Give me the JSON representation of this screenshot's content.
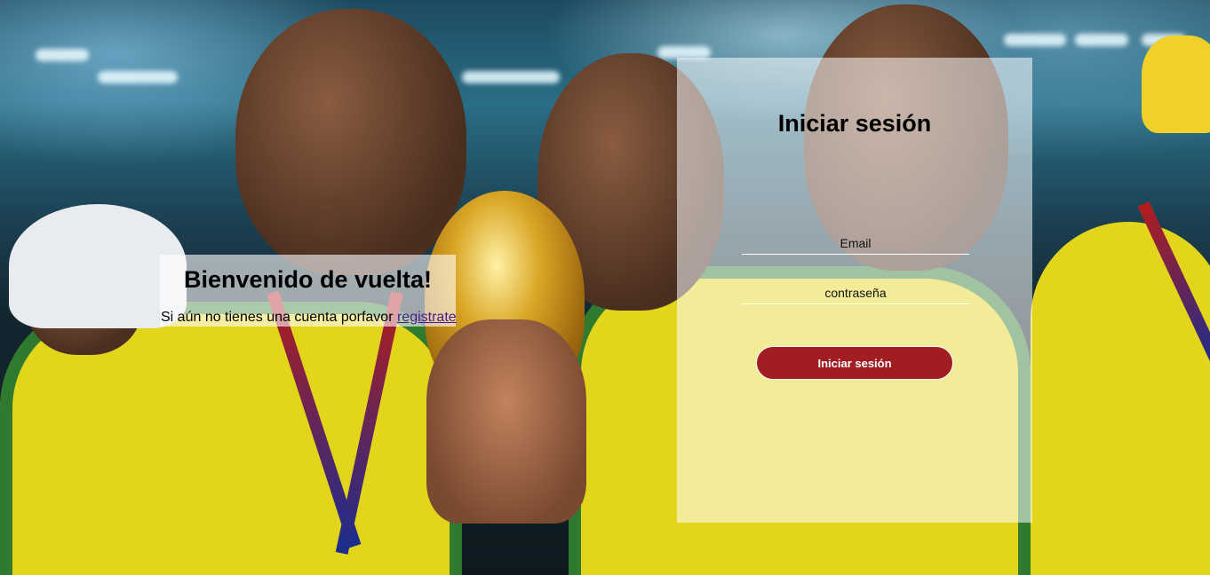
{
  "welcome": {
    "title": "Bienvenido de vuelta!",
    "message": "Si aún no tienes una cuenta porfavor",
    "register_link": "registrate"
  },
  "login": {
    "title": "Iniciar sesión",
    "email_placeholder": "Email",
    "password_placeholder": "contraseña",
    "submit_label": "Iniciar sesión"
  },
  "colors": {
    "button_background": "#a01e22",
    "panel_overlay": "rgba(255,255,255,0.55)"
  }
}
